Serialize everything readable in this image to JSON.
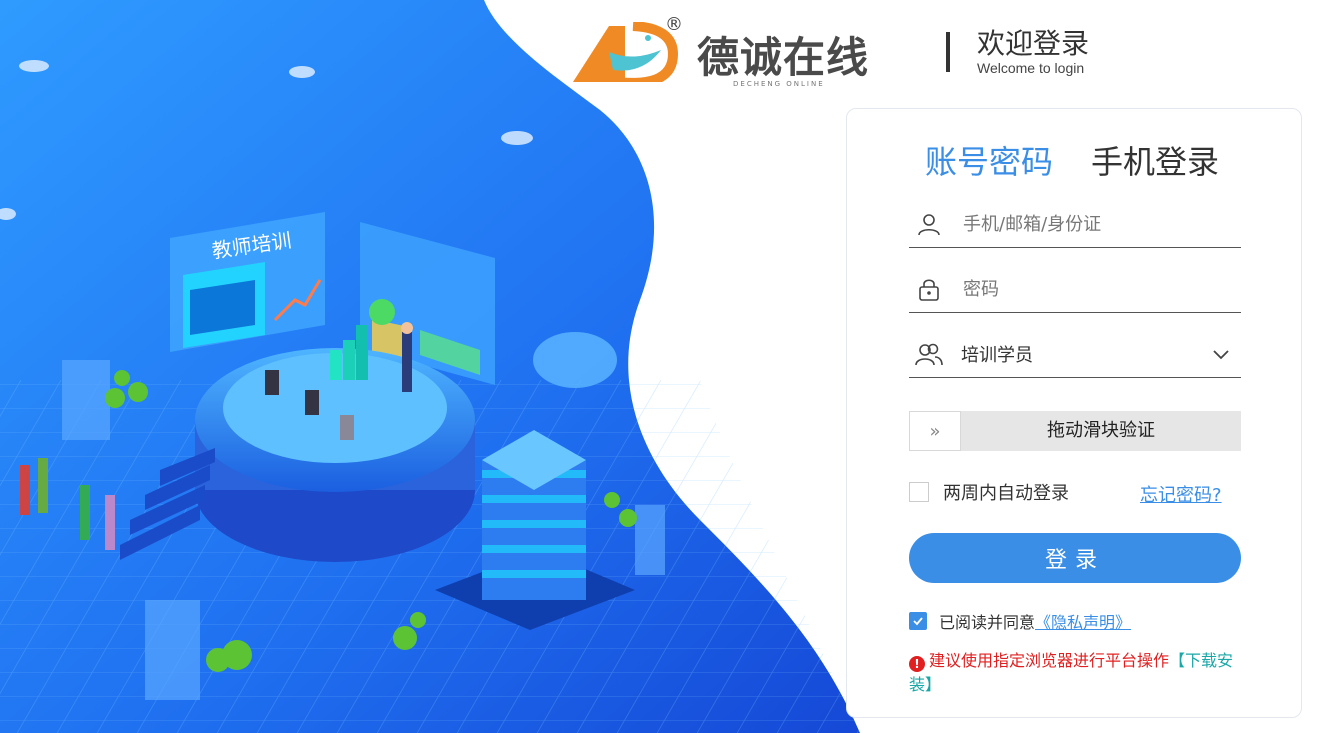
{
  "brand": {
    "name": "德诚在线",
    "registered": "®",
    "subtitle": "DECHENG ONLINE",
    "colors": {
      "orange": "#f08a24",
      "teal": "#4ec3d2",
      "text": "#4a4a4a"
    }
  },
  "header": {
    "welcome_cn": "欢迎登录",
    "welcome_en": "Welcome to login"
  },
  "illustration": {
    "board_title": "教师培训"
  },
  "login": {
    "tabs": [
      {
        "label": "账号密码",
        "active": true
      },
      {
        "label": "手机登录",
        "active": false
      }
    ],
    "account": {
      "placeholder": "手机/邮箱/身份证",
      "icon": "user-icon"
    },
    "password": {
      "placeholder": "密码",
      "icon": "lock-icon"
    },
    "role": {
      "value": "培训学员",
      "icon": "users-icon"
    },
    "slider": {
      "handle": "»",
      "text": "拖动滑块验证"
    },
    "remember_label": "两周内自动登录",
    "forgot_label": "忘记密码?",
    "submit_label": "登录",
    "agree_prefix": "已阅读并同意",
    "privacy_label": "《隐私声明》",
    "warning_text": "建议使用指定浏览器进行平台操作",
    "download_label": "【下载安装】"
  },
  "colors": {
    "accent": "#3a8ee6",
    "warning": "#e02020",
    "link_teal": "#1aa7a7",
    "hero_blue": "#1f6ff0"
  }
}
